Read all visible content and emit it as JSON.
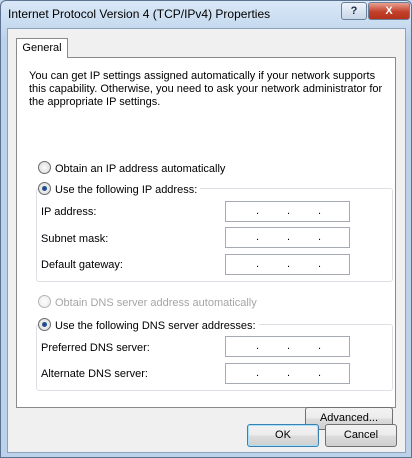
{
  "window": {
    "title": "Internet Protocol Version 4 (TCP/IPv4) Properties",
    "help_label": "?",
    "close_label": "X"
  },
  "tabs": {
    "general": "General"
  },
  "intro_text": "You can get IP settings assigned automatically if your network supports this capability. Otherwise, you need to ask your network administrator for the appropriate IP settings.",
  "ip_section": {
    "auto_label": "Obtain an IP address automatically",
    "manual_label": "Use the following IP address:",
    "selected": "manual",
    "fields": [
      {
        "label": "IP address:",
        "value": ". . ."
      },
      {
        "label": "Subnet mask:",
        "value": ". . ."
      },
      {
        "label": "Default gateway:",
        "value": ". . ."
      }
    ]
  },
  "dns_section": {
    "auto_label": "Obtain DNS server address automatically",
    "manual_label": "Use the following DNS server addresses:",
    "selected": "manual",
    "fields": [
      {
        "label": "Preferred DNS server:",
        "value": ". . ."
      },
      {
        "label": "Alternate DNS server:",
        "value": ". . ."
      }
    ]
  },
  "buttons": {
    "advanced": "Advanced...",
    "ok": "OK",
    "cancel": "Cancel"
  }
}
